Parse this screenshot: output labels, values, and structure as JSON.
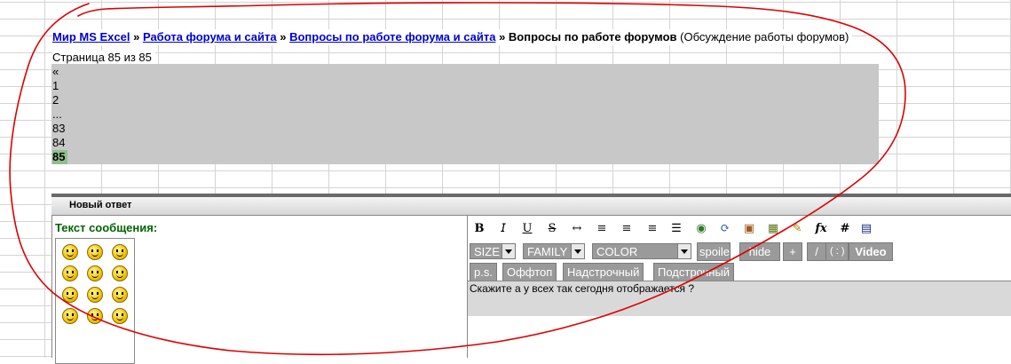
{
  "breadcrumb": {
    "items": [
      "Мир MS Excel",
      "Работа форума и сайта",
      "Вопросы по работе форума и сайта"
    ],
    "separator": "»",
    "current": "Вопросы по работе форумов",
    "description": "(Обсуждение работы форумов)"
  },
  "pagination": {
    "info": "Страница 85 из 85",
    "prev": "«",
    "pages": [
      "1",
      "2",
      "...",
      "83",
      "84"
    ],
    "current_page": "85"
  },
  "reply": {
    "bar_title": "Новый ответ",
    "message_label": "Текст сообщения:",
    "toolbar_icons": [
      "bold-icon",
      "italic-icon",
      "underline-icon",
      "strike-icon",
      "arrows-icon",
      "align-left-icon",
      "align-center-icon",
      "align-right-icon",
      "list-icon",
      "globe-icon",
      "refresh-icon",
      "image-icon",
      "picture-icon",
      "note-icon",
      "formula-icon",
      "hash-icon",
      "table-icon"
    ],
    "toolbar_glyphs": [
      "B",
      "𝘐",
      "U",
      "S",
      "↔",
      "≡",
      "≡",
      "≡",
      "☰",
      "◉",
      "⟳",
      "▣",
      "▦",
      "✎",
      "fx",
      "#",
      "▤"
    ],
    "selects": {
      "size": "SIZE",
      "family": "FAMILY",
      "color": "COLOR"
    },
    "buttons_row1": [
      "spoile",
      "hide",
      "+",
      "/",
      "( : )",
      "Video"
    ],
    "buttons_row2": [
      "p.s.",
      "Оффтоп",
      "Надстрочный",
      "Подстрочный"
    ],
    "message_text": "Скажите а у всех так сегодня отображается ?",
    "annotation_color": "#dd0000",
    "accent_green": "#006400",
    "link_color": "#0000cc"
  }
}
